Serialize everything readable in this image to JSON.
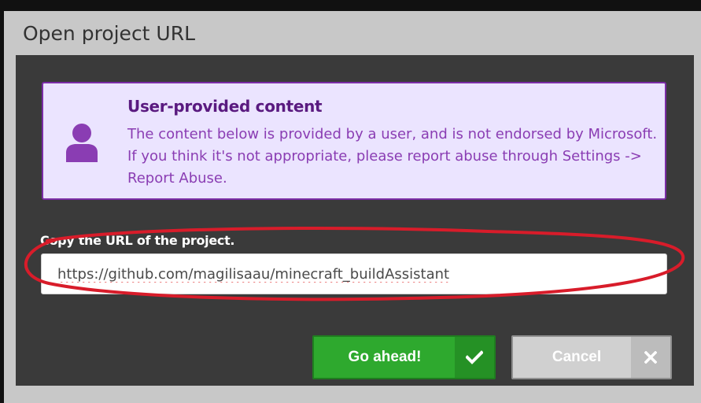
{
  "dialog": {
    "title": "Open project URL"
  },
  "notice": {
    "icon": "user-icon",
    "title": "User-provided content",
    "body": "The content below is provided by a user, and is not endorsed by Microsoft. If you think it's not appropriate, please report abuse through Settings -> Report Abuse."
  },
  "url_field": {
    "label": "Copy the URL of the project.",
    "value": "https://github.com/magilisaau/minecraft_buildAssistant"
  },
  "buttons": {
    "confirm_label": "Go ahead!",
    "confirm_icon": "checkmark-icon",
    "cancel_label": "Cancel",
    "cancel_icon": "close-icon"
  },
  "colors": {
    "notice_border": "#7a2ca6",
    "notice_background": "#ebe4ff",
    "confirm_button": "#2ea92e",
    "cancel_button": "#d0d0d0",
    "annotation_circle": "#d81c2a"
  }
}
